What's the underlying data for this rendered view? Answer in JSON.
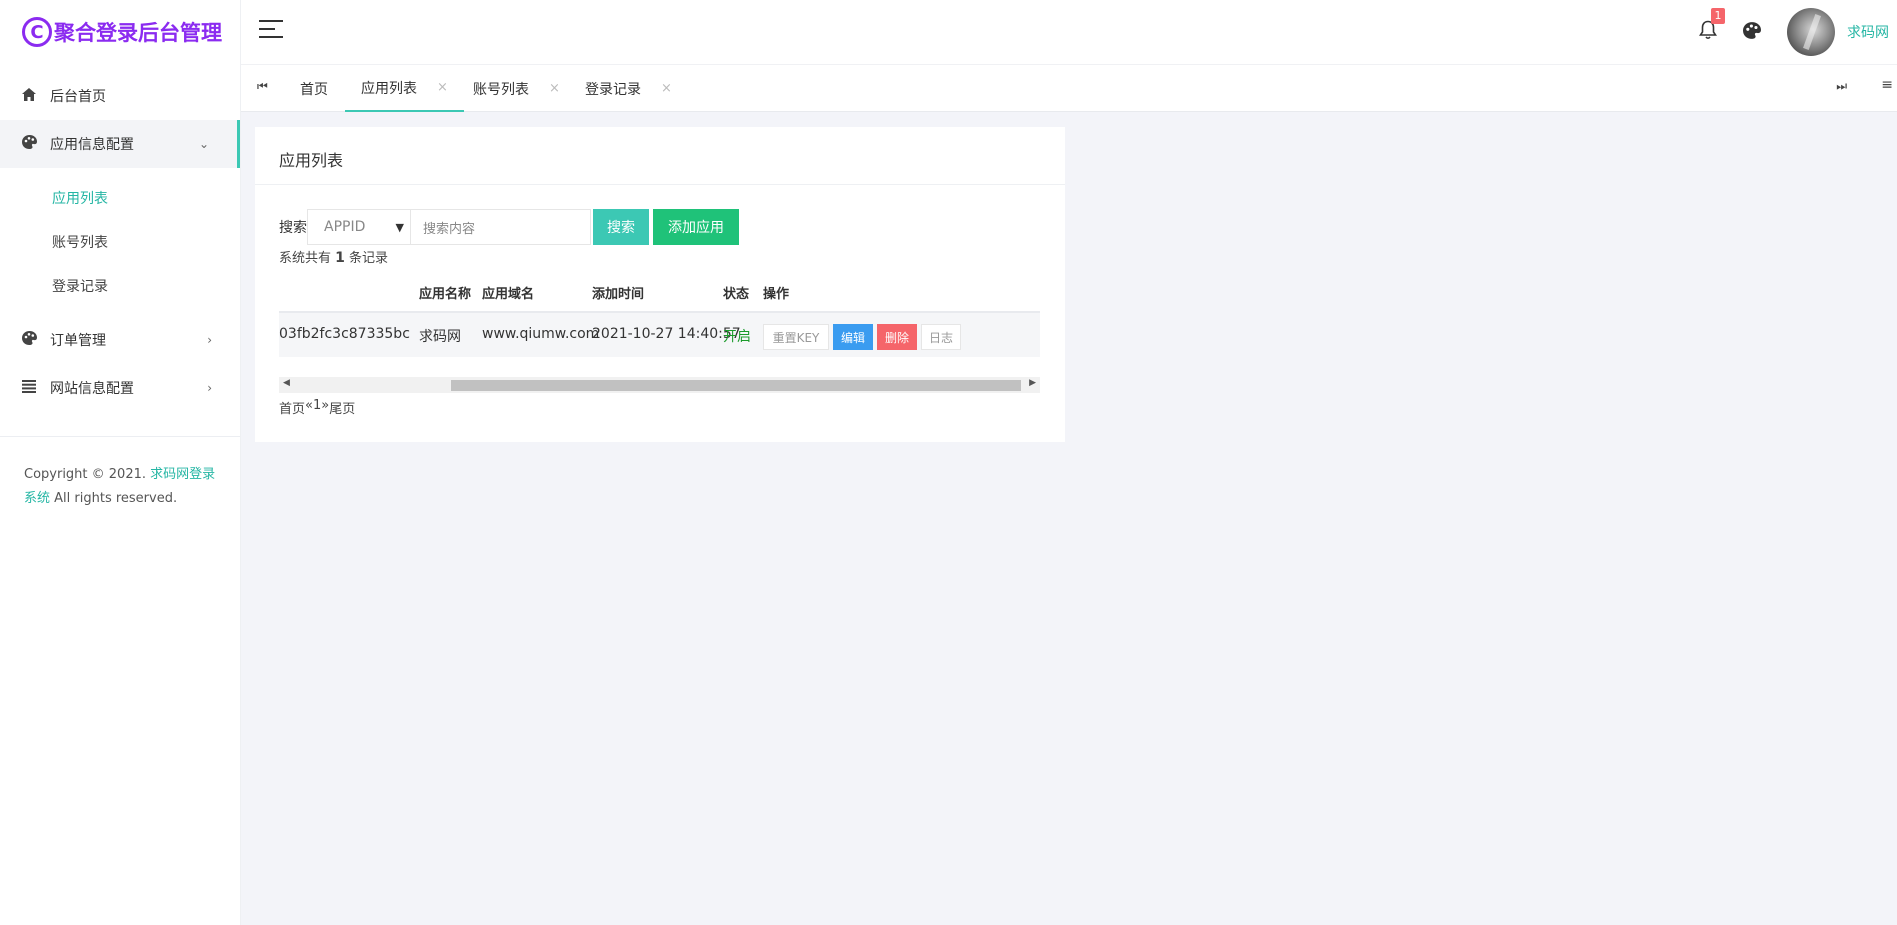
{
  "app": {
    "logo_glyph": "C",
    "title": "聚合登录后台管理",
    "accent": "#3cc8b4",
    "brand": "#8b2bf0"
  },
  "sidebar": {
    "items": [
      {
        "label": "后台首页",
        "icon": "home-icon"
      },
      {
        "label": "应用信息配置",
        "icon": "palette-icon",
        "arrow": "⌄"
      },
      {
        "label": "订单管理",
        "icon": "palette-icon",
        "arrow": "›"
      },
      {
        "label": "网站信息配置",
        "icon": "list-icon",
        "arrow": "›"
      }
    ],
    "submenu": [
      "应用列表",
      "账号列表",
      "登录记录"
    ],
    "copyright": {
      "prefix": "Copyright © 2021. ",
      "link": "求码网登录系统",
      "suffix": " All rights reserved."
    }
  },
  "header": {
    "badge_count": "1",
    "username": "求码网"
  },
  "tabs": [
    {
      "label": "首页",
      "close": ""
    },
    {
      "label": "应用列表",
      "close": "×"
    },
    {
      "label": "账号列表",
      "close": "×"
    },
    {
      "label": "登录记录",
      "close": "×"
    }
  ],
  "nav": {
    "first": "⏮",
    "last": "⏭",
    "menu": "≡"
  },
  "card": {
    "title": "应用列表",
    "search_label": "搜索",
    "select_value": "APPID",
    "search_placeholder": "搜索内容",
    "search_button": "搜索",
    "add_button": "添加应用",
    "summary_prefix": "系统共有 ",
    "summary_count": "1",
    "summary_suffix": " 条记录"
  },
  "table": {
    "headers": [
      "应用名称",
      "应用域名",
      "添加时间",
      "状态",
      "操作"
    ],
    "row": {
      "appid": "03fb2fc3c87335bc",
      "name": "求码网",
      "domain": "www.qiumw.com",
      "time": "2021-10-27 14:40:57",
      "status": "开启",
      "ops": [
        "重置KEY",
        "编辑",
        "删除",
        "日志"
      ]
    }
  },
  "pager": {
    "first": "首页",
    "prev": "«",
    "page": "1",
    "next": "»",
    "last": "尾页"
  }
}
